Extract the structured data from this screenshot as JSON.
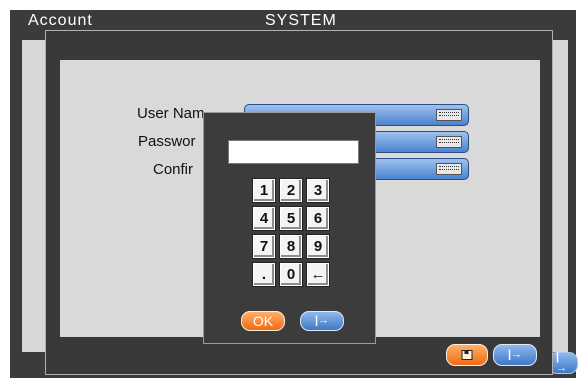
{
  "background_window": {
    "tab_label": "Account",
    "title": "SYSTEM"
  },
  "account_window": {
    "fields": [
      {
        "label": "User Nam"
      },
      {
        "label": "Passwor"
      },
      {
        "label": "Confir"
      }
    ]
  },
  "keypad": {
    "display_value": "",
    "keys": [
      "1",
      "2",
      "3",
      "4",
      "5",
      "6",
      "7",
      "8",
      "9",
      ".",
      "0",
      "←"
    ],
    "ok_label": "OK"
  },
  "icons": {
    "keyboard": "keyboard-icon",
    "save": "save-icon",
    "exit": "exit-icon",
    "exit_glyph": "|→"
  },
  "colors": {
    "window_dark": "#3b3b3b",
    "panel_gray": "#d9d9d9",
    "field_blue": "#6a9ae0",
    "button_orange": "#f58a3a",
    "button_blue": "#5b8fd8"
  }
}
